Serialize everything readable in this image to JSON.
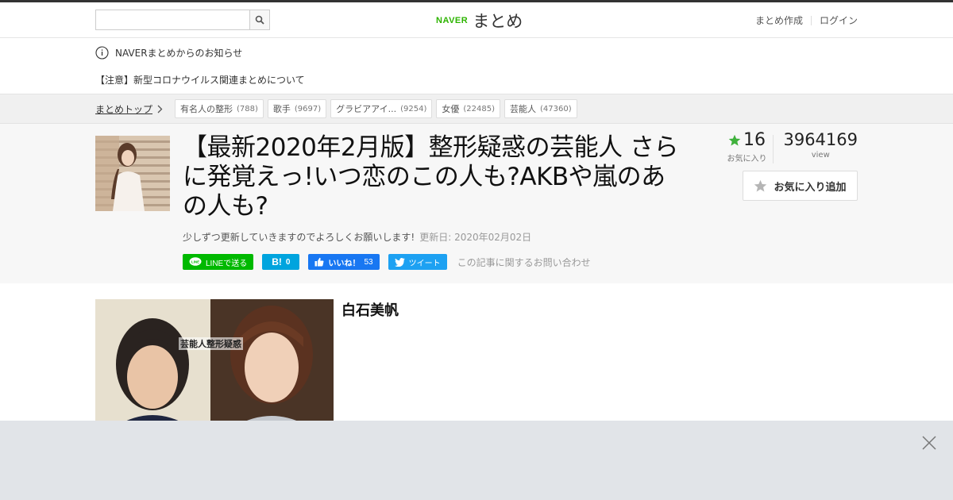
{
  "header": {
    "search": {
      "value": "",
      "placeholder": ""
    },
    "logo": {
      "brand": "NAVER",
      "name": "まとめ"
    },
    "links": {
      "create": "まとめ作成",
      "login": "ログイン"
    }
  },
  "notice": {
    "heading": "NAVERまとめからのお知らせ",
    "link": "【注意】新型コロナウイルス関連まとめについて"
  },
  "breadcrumb": {
    "top": "まとめトップ",
    "tags": [
      {
        "label": "有名人の整形",
        "count": "(788)"
      },
      {
        "label": "歌手",
        "count": "(9697)"
      },
      {
        "label": "グラビアアイ...",
        "count": "(9254)"
      },
      {
        "label": "女優",
        "count": "(22485)"
      },
      {
        "label": "芸能人",
        "count": "(47360)"
      }
    ]
  },
  "article": {
    "title": "【最新2020年2月版】整形疑惑の芸能人 さらに発覚えっ!いつ恋のこの人も?AKBや嵐のあの人も?",
    "description": "少しずつ更新していきますのでよろしくお願いします!",
    "updated": "更新日: 2020年02月02日",
    "share": {
      "line": "LINEで送る",
      "hatena_icon": "B!",
      "hatena_count": "0",
      "facebook": "いいね！",
      "facebook_count": "53",
      "twitter": "ツイート"
    },
    "inquiry": "この記事に関するお問い合わせ",
    "stats": {
      "favorites": "16",
      "favorites_label": "お気に入り",
      "views": "3964169",
      "views_label": "view"
    },
    "favorite_button": "お気に入り追加"
  },
  "content": {
    "photo_caption": "芸能人整形疑惑",
    "item_name": "白石美帆"
  },
  "colors": {
    "naver_green": "#2db400",
    "line": "#00b900",
    "hatena": "#00a4de",
    "facebook": "#1877f2",
    "twitter": "#1da1f2",
    "star": "#3fb13c"
  },
  "icons": [
    "search-icon",
    "info-icon",
    "chevron-right-icon",
    "star-icon",
    "line-icon",
    "facebook-like-icon",
    "twitter-icon",
    "close-icon"
  ]
}
